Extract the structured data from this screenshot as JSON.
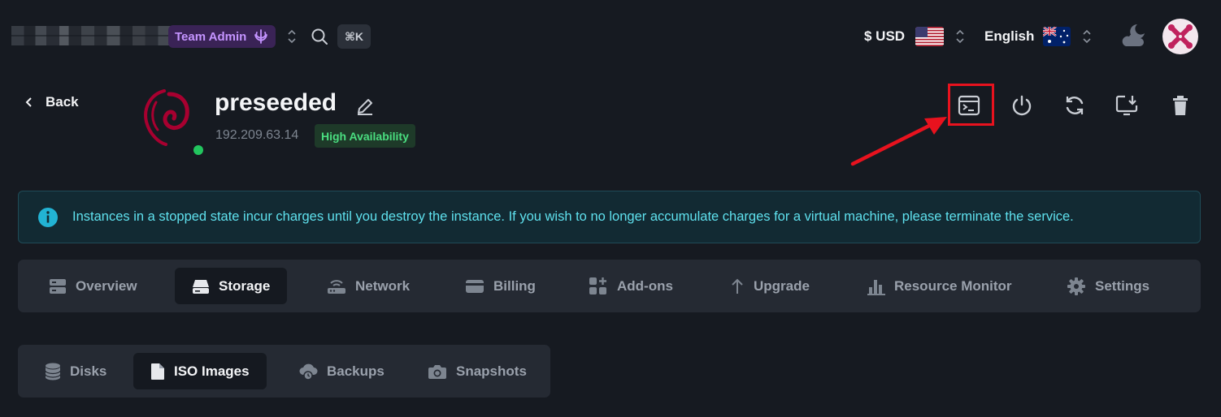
{
  "topbar": {
    "team_label": "Team Admin",
    "shortcut": "⌘K",
    "currency": "$ USD",
    "language": "English",
    "icons": [
      "team-emblem-icon",
      "up-down-chevron-icon",
      "search-icon",
      "moon-cloud-icon",
      "avatar"
    ]
  },
  "header": {
    "back_label": "Back",
    "instance_name": "preseeded",
    "ip_address": "192.209.63.14",
    "badge": "High Availability",
    "status_color": "#22c55e",
    "actions": [
      "console-icon",
      "power-icon",
      "restart-icon",
      "install-icon",
      "delete-icon"
    ]
  },
  "alert": {
    "message": "Instances in a stopped state incur charges until you destroy the instance. If you wish to no longer accumulate charges for a virtual machine, please terminate the service."
  },
  "tabs": [
    {
      "label": "Overview",
      "active": false
    },
    {
      "label": "Storage",
      "active": true
    },
    {
      "label": "Network",
      "active": false
    },
    {
      "label": "Billing",
      "active": false
    },
    {
      "label": "Add-ons",
      "active": false
    },
    {
      "label": "Upgrade",
      "active": false
    },
    {
      "label": "Resource Monitor",
      "active": false
    },
    {
      "label": "Settings",
      "active": false
    }
  ],
  "subtabs": [
    {
      "label": "Disks",
      "active": false
    },
    {
      "label": "ISO Images",
      "active": true
    },
    {
      "label": "Backups",
      "active": false
    },
    {
      "label": "Snapshots",
      "active": false
    }
  ],
  "colors": {
    "background": "#161a21",
    "accent_purple": "#c494ff",
    "alert_text": "#5fe1ee",
    "badge_green": "#4ade80",
    "annotation_red": "#e8121e"
  }
}
